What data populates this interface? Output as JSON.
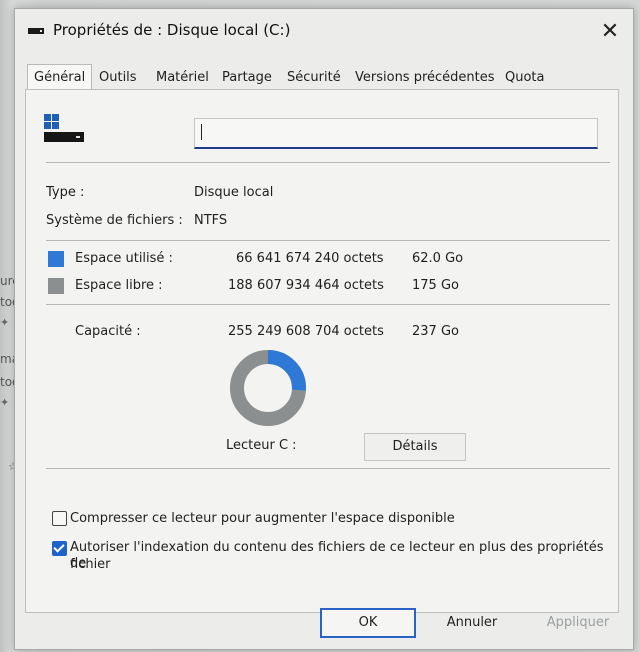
{
  "background": {
    "snippets": [
      "urc",
      "too",
      "ma",
      "too"
    ]
  },
  "window": {
    "title": "Propriétés de : Disque local (C:)",
    "close_symbol": "✕"
  },
  "tabs": [
    {
      "label": "Général"
    },
    {
      "label": "Outils"
    },
    {
      "label": "Matériel"
    },
    {
      "label": "Partage"
    },
    {
      "label": "Sécurité"
    },
    {
      "label": "Versions précédentes"
    },
    {
      "label": "Quota"
    }
  ],
  "general": {
    "name_value": "",
    "type_label": "Type :",
    "type_value": "Disque local",
    "fs_label": "Système de fichiers :",
    "fs_value": "NTFS",
    "used": {
      "label": "Espace utilisé :",
      "bytes": "66 641 674 240 octets",
      "size": "62.0 Go",
      "color": "#2e79d6"
    },
    "free": {
      "label": "Espace libre :",
      "bytes": "188 607 934 464 octets",
      "size": "175 Go",
      "color": "#8c8f8f"
    },
    "capacity": {
      "label": "Capacité :",
      "bytes": "255 249 608 704 octets",
      "size": "237 Go"
    },
    "used_fraction": 0.261,
    "drive_label": "Lecteur C :",
    "details_button": "Détails",
    "compress_checkbox": {
      "label": "Compresser ce lecteur pour augmenter l'espace disponible",
      "checked": false
    },
    "index_checkbox": {
      "label_line1": "Autoriser l'indexation du contenu des fichiers de ce lecteur en plus des propriétés de",
      "label_line2": "fichier",
      "checked": true
    }
  },
  "buttons": {
    "ok": "OK",
    "cancel": "Annuler",
    "apply": "Appliquer"
  }
}
